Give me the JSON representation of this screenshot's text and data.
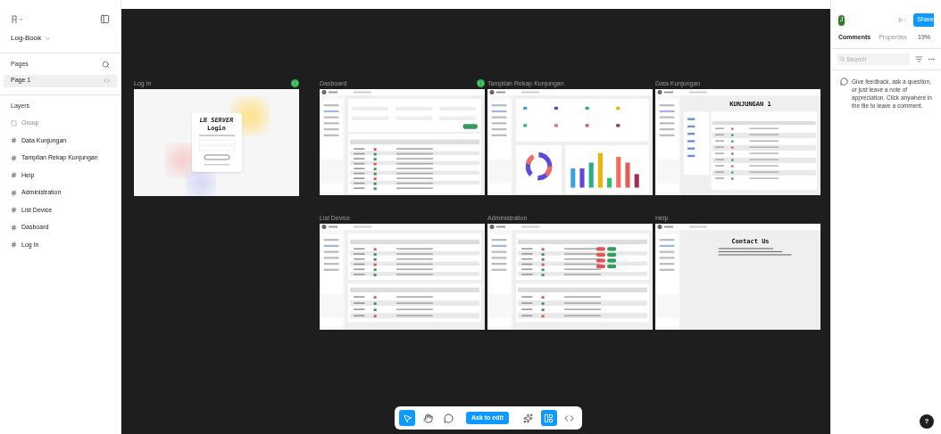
{
  "sidebar": {
    "file_name": "Log-Book",
    "pages_label": "Pages",
    "pages": [
      {
        "name": "Page 1",
        "selected": true
      }
    ],
    "layers_label": "Layers",
    "layers": [
      {
        "name": "Group",
        "kind": "group"
      },
      {
        "name": "Data Kunjungan",
        "kind": "frame"
      },
      {
        "name": "Tampilan Rekap Kunjungan",
        "kind": "frame"
      },
      {
        "name": "Help",
        "kind": "frame"
      },
      {
        "name": "Administration",
        "kind": "frame"
      },
      {
        "name": "List Device",
        "kind": "frame"
      },
      {
        "name": "Dasboard",
        "kind": "frame"
      },
      {
        "name": "Log In",
        "kind": "frame"
      }
    ]
  },
  "canvas": {
    "frames": [
      {
        "title": "Log In",
        "kind": "login",
        "dev_mode": true,
        "brand": "LB SERVER",
        "heading": "Login"
      },
      {
        "title": "Dasboard",
        "kind": "dashboard",
        "dev_mode": true
      },
      {
        "title": "Tampilan Rekap Kunjungan",
        "kind": "recap",
        "dev_mode": false
      },
      {
        "title": "Data Kunjungan",
        "kind": "data",
        "dev_mode": false,
        "heading": "KUNJUNGAN 1"
      },
      {
        "title": "List Device",
        "kind": "list",
        "dev_mode": false
      },
      {
        "title": "Administration",
        "kind": "admin",
        "dev_mode": false
      },
      {
        "title": "Help",
        "kind": "help",
        "dev_mode": false,
        "heading": "Contact Us"
      }
    ]
  },
  "toolbar": {
    "tools": [
      {
        "kind": "pointer",
        "selected": true
      },
      {
        "kind": "hand",
        "selected": false
      },
      {
        "kind": "comment",
        "selected": false
      }
    ],
    "ask_button": "Ask to edit",
    "modes": [
      {
        "kind": "ai",
        "selected": false
      },
      {
        "kind": "design",
        "selected": true
      },
      {
        "kind": "code",
        "selected": false
      }
    ]
  },
  "right_panel": {
    "avatar": "J",
    "share": "Share",
    "tabs": [
      {
        "label": "Comments",
        "selected": true
      },
      {
        "label": "Properties",
        "selected": false
      }
    ],
    "zoom": "19%",
    "search": {
      "placeholder": "Search"
    },
    "hint": "Give feedback, ask a question, or just leave a note of appreciation. Click anywhere in the file to leave a comment."
  },
  "help_button": "?"
}
